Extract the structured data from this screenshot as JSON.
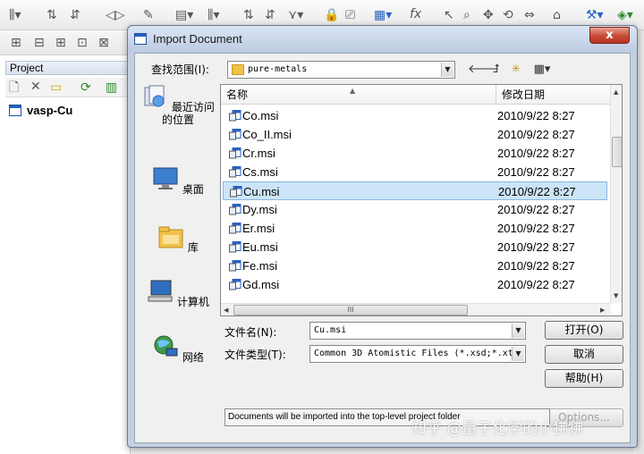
{
  "background_app": {
    "project_panel_title": "Project",
    "project_tree_item": "vasp-Cu"
  },
  "dialog": {
    "title": "Import Document",
    "close_label": "x",
    "look_in_label": "查找范围(I):",
    "look_in_value": "pure-metals",
    "places": [
      {
        "label": "最近访问的位置",
        "icon": "recent-places-icon"
      },
      {
        "label": "桌面",
        "icon": "desktop-icon"
      },
      {
        "label": "库",
        "icon": "libraries-icon"
      },
      {
        "label": "计算机",
        "icon": "computer-icon"
      },
      {
        "label": "网络",
        "icon": "network-icon"
      }
    ],
    "columns": {
      "name": "名称",
      "date": "修改日期"
    },
    "files": [
      {
        "name": "Co.msi",
        "date": "2010/9/22 8:27"
      },
      {
        "name": "Co_II.msi",
        "date": "2010/9/22 8:27"
      },
      {
        "name": "Cr.msi",
        "date": "2010/9/22 8:27"
      },
      {
        "name": "Cs.msi",
        "date": "2010/9/22 8:27"
      },
      {
        "name": "Cu.msi",
        "date": "2010/9/22 8:27",
        "selected": true
      },
      {
        "name": "Dy.msi",
        "date": "2010/9/22 8:27"
      },
      {
        "name": "Er.msi",
        "date": "2010/9/22 8:27"
      },
      {
        "name": "Eu.msi",
        "date": "2010/9/22 8:27"
      },
      {
        "name": "Fe.msi",
        "date": "2010/9/22 8:27"
      },
      {
        "name": "Gd.msi",
        "date": "2010/9/22 8:27"
      }
    ],
    "hscroll_grip": "III",
    "filename_label": "文件名(N):",
    "filename_value": "Cu.msi",
    "filetype_label": "文件类型(T):",
    "filetype_value": "Common 3D Atomistic Files (*.xsd;*.xt",
    "open_button": "打开(O)",
    "cancel_button": "取消",
    "help_button": "帮助(H)",
    "options_button": "Options...",
    "status_text": "Documents will be imported into the top-level project folder"
  },
  "watermark": "知乎 @量子化学的小狒狒",
  "colors": {
    "selection": "#cce4f7",
    "title_bar": "#bccbe2",
    "close": "#c74a36"
  }
}
